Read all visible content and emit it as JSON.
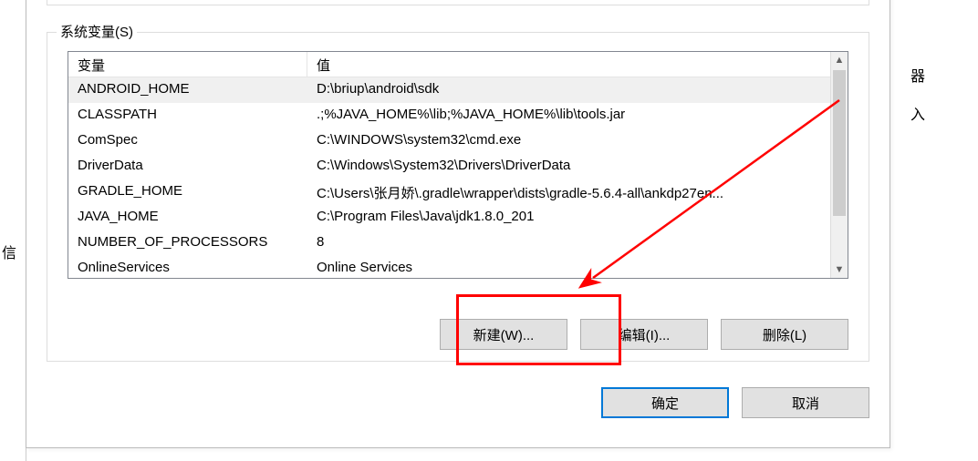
{
  "group": {
    "title": "系统变量(S)"
  },
  "columns": {
    "name": "变量",
    "value": "值"
  },
  "rows": [
    {
      "name": "ANDROID_HOME",
      "value": "D:\\briup\\android\\sdk",
      "selected": true
    },
    {
      "name": "CLASSPATH",
      "value": ".;%JAVA_HOME%\\lib;%JAVA_HOME%\\lib\\tools.jar",
      "selected": false
    },
    {
      "name": "ComSpec",
      "value": "C:\\WINDOWS\\system32\\cmd.exe",
      "selected": false
    },
    {
      "name": "DriverData",
      "value": "C:\\Windows\\System32\\Drivers\\DriverData",
      "selected": false
    },
    {
      "name": "GRADLE_HOME",
      "value": "C:\\Users\\张月娇\\.gradle\\wrapper\\dists\\gradle-5.6.4-all\\ankdp27en...",
      "selected": false
    },
    {
      "name": "JAVA_HOME",
      "value": "C:\\Program Files\\Java\\jdk1.8.0_201",
      "selected": false
    },
    {
      "name": "NUMBER_OF_PROCESSORS",
      "value": "8",
      "selected": false
    },
    {
      "name": "OnlineServices",
      "value": "Online Services",
      "selected": false
    }
  ],
  "buttons": {
    "new": "新建(W)...",
    "edit": "编辑(I)...",
    "delete": "删除(L)",
    "ok": "确定",
    "cancel": "取消"
  },
  "background_text": {
    "left": "信",
    "right1": "器",
    "right2": "入"
  },
  "annotation": {
    "color": "#ff0000"
  }
}
